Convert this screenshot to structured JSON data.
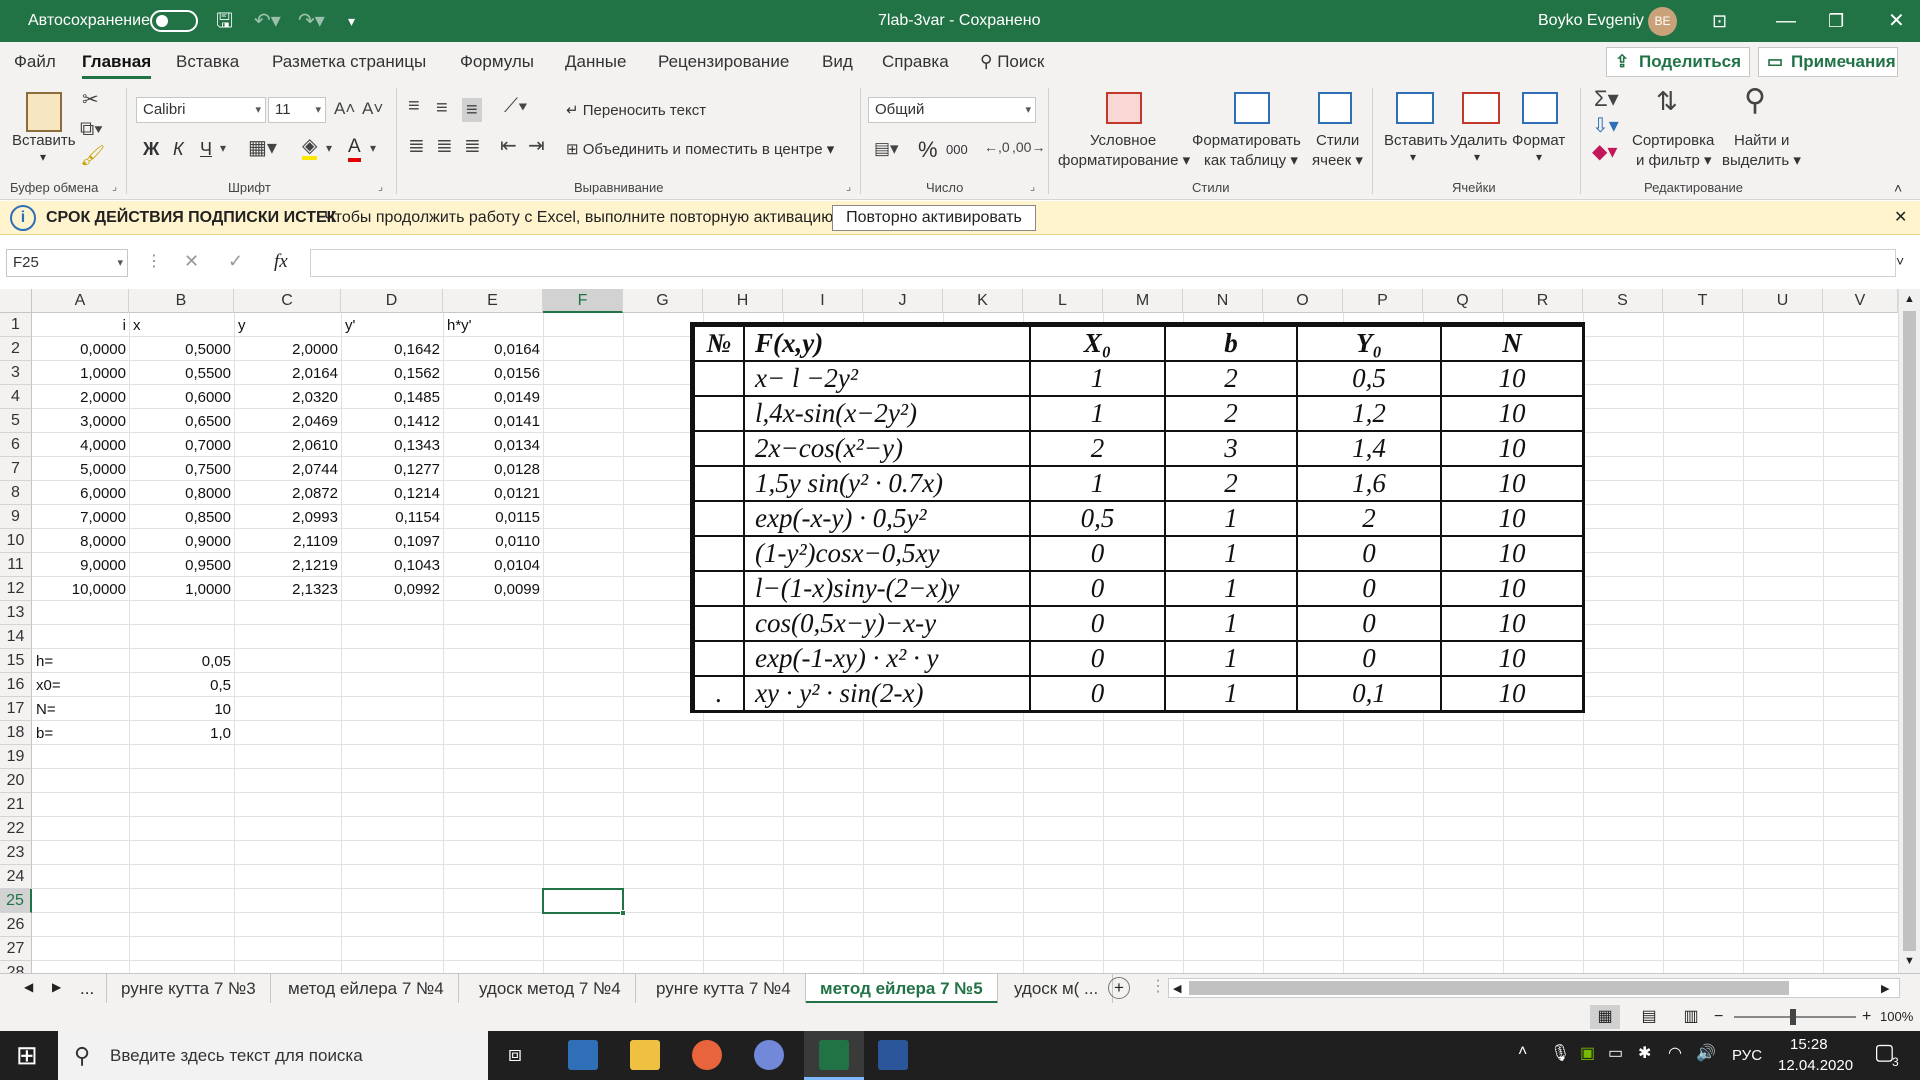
{
  "titlebar": {
    "autosave_label": "Автосохранение",
    "doc_title": "7lab-3var",
    "save_state": "Сохранено",
    "user_name": "Boyko Evgeniy",
    "user_initials": "BE",
    "accent_color": "#217346"
  },
  "menu": {
    "items": [
      "Файл",
      "Главная",
      "Вставка",
      "Разметка страницы",
      "Формулы",
      "Данные",
      "Рецензирование",
      "Вид",
      "Справка"
    ],
    "search_label": "Поиск",
    "share_label": "Поделиться",
    "comments_label": "Примечания"
  },
  "ribbon": {
    "paste_label": "Вставить",
    "clipboard_group": "Буфер обмена",
    "font_name": "Calibri",
    "font_size": "11",
    "bold": "Ж",
    "italic": "К",
    "underline": "Ч",
    "font_color_letter": "A",
    "font_group": "Шрифт",
    "wrap_text": "Переносить текст",
    "merge_center": "Объединить и поместить в центре",
    "alignment_group": "Выравнивание",
    "number_format": "Общий",
    "percent": "%",
    "thousands": "000",
    "number_group": "Число",
    "cond_format_1": "Условное",
    "cond_format_2": "форматирование",
    "format_table_1": "Форматировать",
    "format_table_2": "как таблицу",
    "cell_styles_1": "Стили",
    "cell_styles_2": "ячеек",
    "styles_group": "Стили",
    "insert": "Вставить",
    "delete": "Удалить",
    "format": "Формат",
    "cells_group": "Ячейки",
    "sort_1": "Сортировка",
    "sort_2": "и фильтр",
    "find_1": "Найти и",
    "find_2": "выделить",
    "editing_group": "Редактирование"
  },
  "infobar": {
    "title": "СРОК ДЕЙСТВИЯ ПОДПИСКИ ИСТЕК",
    "message": "Чтобы продолжить работу с Excel, выполните повторную активацию.",
    "button": "Повторно активировать"
  },
  "formula_bar": {
    "name_box": "F25",
    "fx": "fx",
    "content": ""
  },
  "grid": {
    "columns": [
      "A",
      "B",
      "C",
      "D",
      "E",
      "F",
      "G",
      "H",
      "I",
      "J",
      "K",
      "L",
      "M",
      "N",
      "O",
      "P",
      "Q",
      "R",
      "S",
      "T",
      "U",
      "V"
    ],
    "rows": [
      "1",
      "2",
      "3",
      "4",
      "5",
      "6",
      "7",
      "8",
      "9",
      "10",
      "11",
      "12",
      "13",
      "14",
      "15",
      "16",
      "17",
      "18",
      "19",
      "20",
      "21",
      "22",
      "23",
      "24",
      "25",
      "26",
      "27",
      "28"
    ],
    "header_row": {
      "A": "i",
      "B": "x",
      "C": "y",
      "D": "y'",
      "E": "h*y'"
    },
    "data_rows": [
      [
        "0,0000",
        "0,5000",
        "2,0000",
        "0,1642",
        "0,0164"
      ],
      [
        "1,0000",
        "0,5500",
        "2,0164",
        "0,1562",
        "0,0156"
      ],
      [
        "2,0000",
        "0,6000",
        "2,0320",
        "0,1485",
        "0,0149"
      ],
      [
        "3,0000",
        "0,6500",
        "2,0469",
        "0,1412",
        "0,0141"
      ],
      [
        "4,0000",
        "0,7000",
        "2,0610",
        "0,1343",
        "0,0134"
      ],
      [
        "5,0000",
        "0,7500",
        "2,0744",
        "0,1277",
        "0,0128"
      ],
      [
        "6,0000",
        "0,8000",
        "2,0872",
        "0,1214",
        "0,0121"
      ],
      [
        "7,0000",
        "0,8500",
        "2,0993",
        "0,1154",
        "0,0115"
      ],
      [
        "8,0000",
        "0,9000",
        "2,1109",
        "0,1097",
        "0,0110"
      ],
      [
        "9,0000",
        "0,9500",
        "2,1219",
        "0,1043",
        "0,0104"
      ],
      [
        "10,0000",
        "1,0000",
        "2,1323",
        "0,0992",
        "0,0099"
      ]
    ],
    "params": [
      {
        "label": "h=",
        "value": "0,05"
      },
      {
        "label": "x0=",
        "value": "0,5"
      },
      {
        "label": "N=",
        "value": "10"
      },
      {
        "label": "b=",
        "value": "1,0"
      }
    ],
    "selected_cell": "F25"
  },
  "image_table": {
    "headers": [
      "№",
      "F(x,y)",
      "X₀",
      "b",
      "Y₀",
      "N"
    ],
    "rows": [
      [
        "",
        "x− l −2y²",
        "1",
        "2",
        "0,5",
        "10"
      ],
      [
        "",
        "l,4x-sin(x−2y²)",
        "1",
        "2",
        "1,2",
        "10"
      ],
      [
        "",
        "2x−cos(x²−y)",
        "2",
        "3",
        "1,4",
        "10"
      ],
      [
        "",
        "1,5y  sin(y² · 0.7x)",
        "1",
        "2",
        "1,6",
        "10"
      ],
      [
        "",
        "exp(-x-y) · 0,5y²",
        "0,5",
        "1",
        "2",
        "10"
      ],
      [
        "",
        "(1-y²)cosx−0,5xy",
        "0",
        "1",
        "0",
        "10"
      ],
      [
        "",
        "l−(1-x)siny-(2−x)y",
        "0",
        "1",
        "0",
        "10"
      ],
      [
        "",
        "cos(0,5x−y)−x-y",
        "0",
        "1",
        "0",
        "10"
      ],
      [
        "",
        "exp(-1-xy) · x² · y",
        "0",
        "1",
        "0",
        "10"
      ],
      [
        ".",
        "xy · y² · sin(2-x)",
        "0",
        "1",
        "0,1",
        "10"
      ]
    ]
  },
  "sheet_tabs": {
    "ellipsis": "...",
    "tabs": [
      "рунге кутта 7 №3",
      "метод ейлера 7 №4",
      "удоск метод 7 №4",
      "рунге кутта 7 №4",
      "метод ейлера 7 №5",
      "удоск м( ..."
    ],
    "active_index": 4
  },
  "status": {
    "zoom": "100%"
  },
  "taskbar": {
    "search_placeholder": "Введите здесь текст для поиска",
    "lang": "РУС",
    "time": "15:28",
    "date": "12.04.2020",
    "notifications": "3"
  }
}
